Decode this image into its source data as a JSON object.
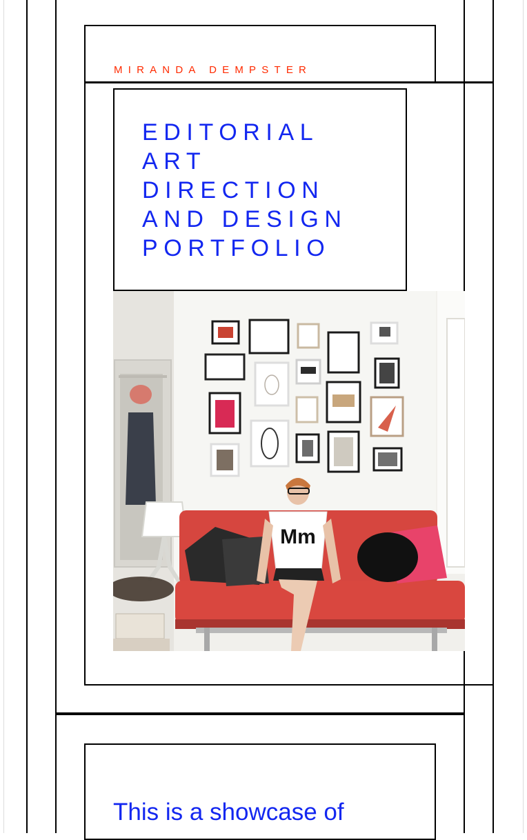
{
  "brand": {
    "name": "MIRANDA DEMPSTER"
  },
  "hero": {
    "title_lines": [
      "EDITORIAL",
      "ART",
      "DIRECTION",
      "AND DESIGN",
      "PORTFOLIO"
    ],
    "photo": {
      "shirt_text": "Mm"
    }
  },
  "intro": {
    "text": "This is a showcase of"
  },
  "colors": {
    "brand_red": "#ff2a00",
    "title_blue": "#1327f0",
    "rule_black": "#000000"
  }
}
